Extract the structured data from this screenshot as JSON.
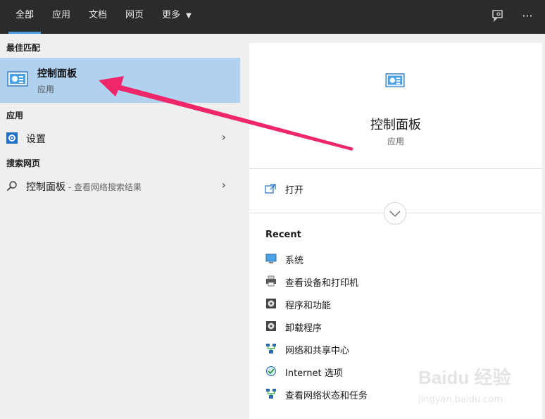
{
  "tabs": [
    {
      "label": "全部",
      "active": true
    },
    {
      "label": "应用",
      "active": false
    },
    {
      "label": "文档",
      "active": false
    },
    {
      "label": "网页",
      "active": false
    },
    {
      "label": "更多",
      "active": false
    }
  ],
  "top_icons": [
    "feedback-icon",
    "more-options-icon"
  ],
  "left": {
    "best_match_head": "最佳匹配",
    "best_match": {
      "title": "控制面板",
      "sub": "应用",
      "icon": "control-panel-icon"
    },
    "apps_head": "应用",
    "settings_label": "设置",
    "web_head": "搜索网页",
    "web_item": {
      "label": "控制面板",
      "hint": " - 查看网络搜索结果"
    }
  },
  "right": {
    "title": "控制面板",
    "sub": "应用",
    "open_label": "打开",
    "recent_head": "Recent",
    "recent_items": [
      {
        "label": "系统",
        "icon": "system-icon"
      },
      {
        "label": "查看设备和打印机",
        "icon": "printer-icon"
      },
      {
        "label": "程序和功能",
        "icon": "programs-icon"
      },
      {
        "label": "卸载程序",
        "icon": "uninstall-icon"
      },
      {
        "label": "网络和共享中心",
        "icon": "network-icon"
      },
      {
        "label": "Internet 选项",
        "icon": "internet-options-icon"
      },
      {
        "label": "查看网络状态和任务",
        "icon": "network-status-icon"
      }
    ]
  },
  "colors": {
    "topbar": "#2b2b2b",
    "accent": "#4a9be0",
    "selected": "#b0d2ee",
    "arrow": "#f0266b"
  },
  "watermark": {
    "brand": "Baidu 经验",
    "url": "jingyan.baidu.com"
  }
}
